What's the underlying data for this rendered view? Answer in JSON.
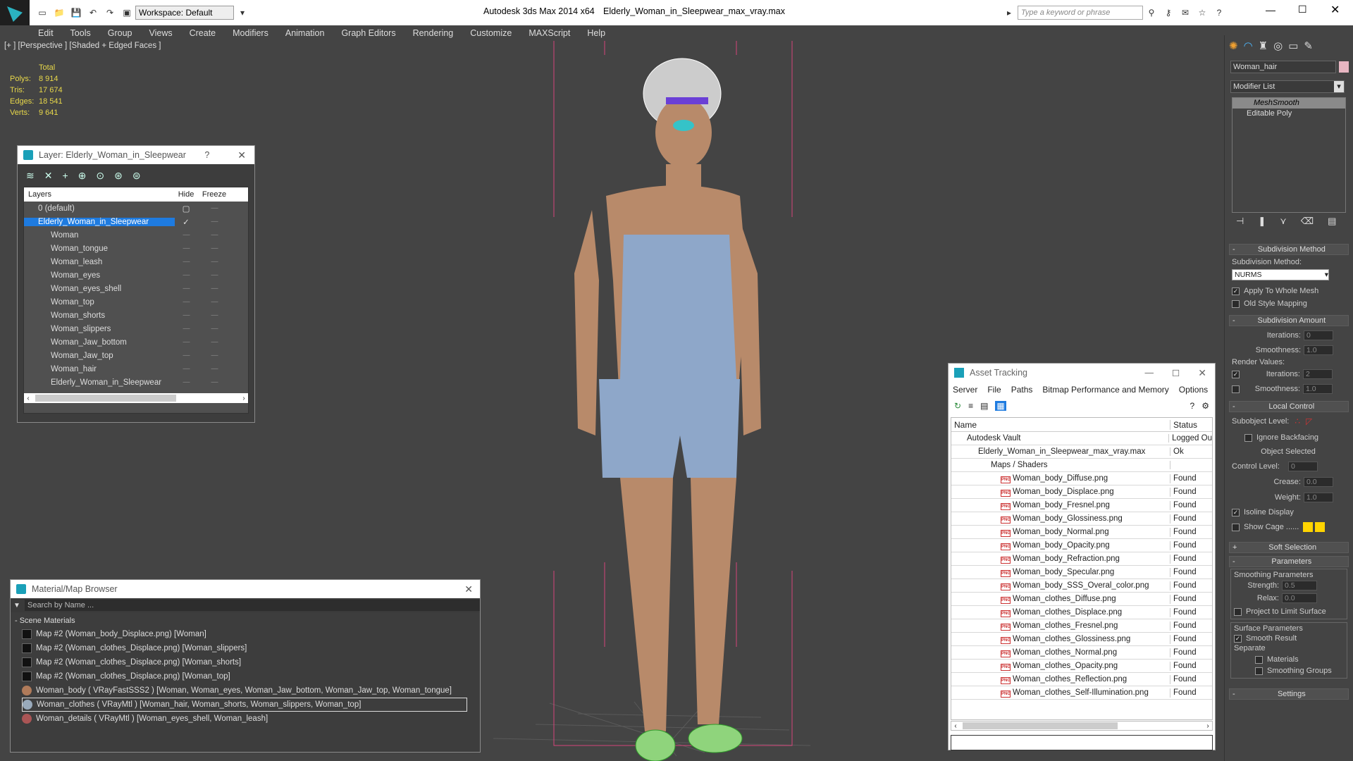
{
  "title_bar": {
    "app": "Autodesk 3ds Max  2014 x64",
    "file": "Elderly_Woman_in_Sleepwear_max_vray.max",
    "workspace": "Workspace: Default",
    "search_placeholder": "Type a keyword or phrase"
  },
  "menu": [
    "Edit",
    "Tools",
    "Group",
    "Views",
    "Create",
    "Modifiers",
    "Animation",
    "Graph Editors",
    "Rendering",
    "Customize",
    "MAXScript",
    "Help"
  ],
  "viewport": {
    "label": "[+ ] [Perspective ] [Shaded + Edged Faces ]",
    "stats_header": "Total",
    "stats": [
      {
        "k": "Polys:",
        "v": "8 914"
      },
      {
        "k": "Tris:",
        "v": "17 674"
      },
      {
        "k": "Edges:",
        "v": "18 541"
      },
      {
        "k": "Verts:",
        "v": "9 641"
      }
    ]
  },
  "layer_dialog": {
    "title": "Layer: Elderly_Woman_in_Sleepwear",
    "help": "?",
    "col_layers": "Layers",
    "col_hide": "Hide",
    "col_freeze": "Freeze",
    "layers": [
      "0 (default)",
      "Elderly_Woman_in_Sleepwear"
    ],
    "objects": [
      "Woman",
      "Woman_tongue",
      "Woman_leash",
      "Woman_eyes",
      "Woman_eyes_shell",
      "Woman_top",
      "Woman_shorts",
      "Woman_slippers",
      "Woman_Jaw_bottom",
      "Woman_Jaw_top",
      "Woman_hair",
      "Elderly_Woman_in_Sleepwear"
    ]
  },
  "material_browser": {
    "title": "Material/Map Browser",
    "search_placeholder": "Search by Name ...",
    "group": "- Scene Materials",
    "items": [
      "Map #2 (Woman_body_Displace.png) [Woman]",
      "Map #2 (Woman_clothes_Displace.png) [Woman_slippers]",
      "Map #2 (Woman_clothes_Displace.png) [Woman_shorts]",
      "Map #2 (Woman_clothes_Displace.png) [Woman_top]",
      "Woman_body  ( VRayFastSSS2 ) [Woman, Woman_eyes, Woman_Jaw_bottom, Woman_Jaw_top, Woman_tongue]",
      "Woman_clothes  ( VRayMtl ) [Woman_hair, Woman_shorts, Woman_slippers, Woman_top]",
      "Woman_details  ( VRayMtl ) [Woman_eyes_shell, Woman_leash]"
    ]
  },
  "asset_tracking": {
    "title": "Asset Tracking",
    "menu": [
      "Server",
      "File",
      "Paths",
      "Bitmap Performance and Memory",
      "Options"
    ],
    "col_name": "Name",
    "col_status": "Status",
    "vault": {
      "name": "Autodesk Vault",
      "status": "Logged Ou"
    },
    "file": {
      "name": "Elderly_Woman_in_Sleepwear_max_vray.max",
      "status": "Ok"
    },
    "group": "Maps / Shaders",
    "maps": [
      {
        "n": "Woman_body_Diffuse.png",
        "s": "Found"
      },
      {
        "n": "Woman_body_Displace.png",
        "s": "Found"
      },
      {
        "n": "Woman_body_Fresnel.png",
        "s": "Found"
      },
      {
        "n": "Woman_body_Glossiness.png",
        "s": "Found"
      },
      {
        "n": "Woman_body_Normal.png",
        "s": "Found"
      },
      {
        "n": "Woman_body_Opacity.png",
        "s": "Found"
      },
      {
        "n": "Woman_body_Refraction.png",
        "s": "Found"
      },
      {
        "n": "Woman_body_Specular.png",
        "s": "Found"
      },
      {
        "n": "Woman_body_SSS_Overal_color.png",
        "s": "Found"
      },
      {
        "n": "Woman_clothes_Diffuse.png",
        "s": "Found"
      },
      {
        "n": "Woman_clothes_Displace.png",
        "s": "Found"
      },
      {
        "n": "Woman_clothes_Fresnel.png",
        "s": "Found"
      },
      {
        "n": "Woman_clothes_Glossiness.png",
        "s": "Found"
      },
      {
        "n": "Woman_clothes_Normal.png",
        "s": "Found"
      },
      {
        "n": "Woman_clothes_Opacity.png",
        "s": "Found"
      },
      {
        "n": "Woman_clothes_Reflection.png",
        "s": "Found"
      },
      {
        "n": "Woman_clothes_Self-Illumination.png",
        "s": "Found"
      }
    ]
  },
  "command_panel": {
    "object_name": "Woman_hair",
    "modifier_list": "Modifier List",
    "stack": [
      "MeshSmooth",
      "Editable Poly"
    ],
    "subdivision_method": {
      "title": "Subdivision Method",
      "label": "Subdivision Method:",
      "value": "NURMS",
      "apply": "Apply To Whole Mesh",
      "old": "Old Style Mapping"
    },
    "subdivision_amount": {
      "title": "Subdivision Amount",
      "iterations_label": "Iterations:",
      "iterations": "0",
      "smoothness_label": "Smoothness:",
      "smoothness": "1.0",
      "render_values": "Render Values:",
      "r_iterations": "2",
      "r_smoothness": "1.0"
    },
    "local_control": {
      "title": "Local Control",
      "subobject": "Subobject Level:",
      "ignore": "Ignore Backfacing",
      "object_selected": "Object Selected",
      "control_level": "Control Level:",
      "control_value": "0",
      "crease": "Crease:",
      "crease_val": "0.0",
      "weight": "Weight:",
      "weight_val": "1.0",
      "isoline": "Isoline Display",
      "show_cage": "Show Cage ......"
    },
    "soft_selection": "Soft Selection",
    "parameters": {
      "title": "Parameters",
      "smoothing": "Smoothing Parameters",
      "strength": "Strength:",
      "strength_val": "0.5",
      "relax": "Relax:",
      "relax_val": "0.0",
      "project": "Project to Limit Surface",
      "surface": "Surface Parameters",
      "smooth_result": "Smooth Result",
      "separate": "Separate",
      "materials": "Materials",
      "smoothing_groups": "Smoothing Groups"
    },
    "settings": "Settings"
  },
  "colors": {
    "accent": "#1e7be0",
    "cage1": "#ffd400",
    "cage2": "#ffd400"
  }
}
